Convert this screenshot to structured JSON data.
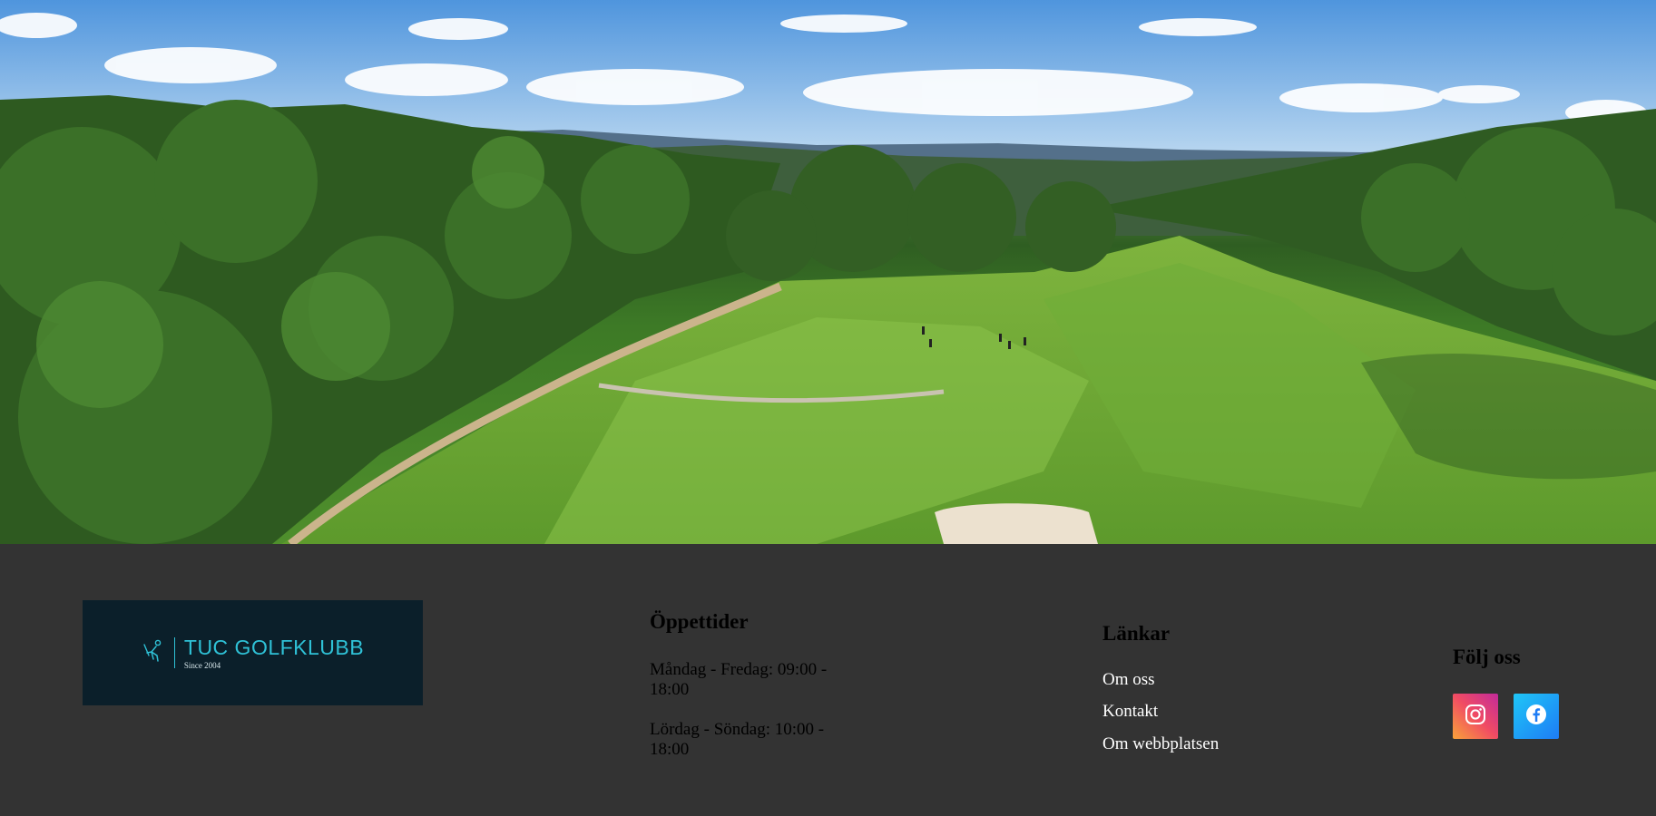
{
  "hero": {
    "image": "golf-course-aerial-photo"
  },
  "footer": {
    "logo": {
      "name": "TUC GOLFKLUBB",
      "since": "Since 2004",
      "icon": "golfer-icon",
      "accent_color": "#2fc1d6",
      "background_color": "#0b1f2a"
    },
    "hours": {
      "title": "Öppettider",
      "weekdays": "Måndag - Fredag: 09:00 - 18:00",
      "weekend": "Lördag - Söndag: 10:00 - 18:00"
    },
    "links": {
      "title": "Länkar",
      "items": [
        "Om oss",
        "Kontakt",
        "Om webbplatsen"
      ]
    },
    "follow": {
      "title": "Följ oss",
      "icons": [
        "instagram-icon",
        "facebook-icon"
      ]
    },
    "background_color": "#333333"
  }
}
